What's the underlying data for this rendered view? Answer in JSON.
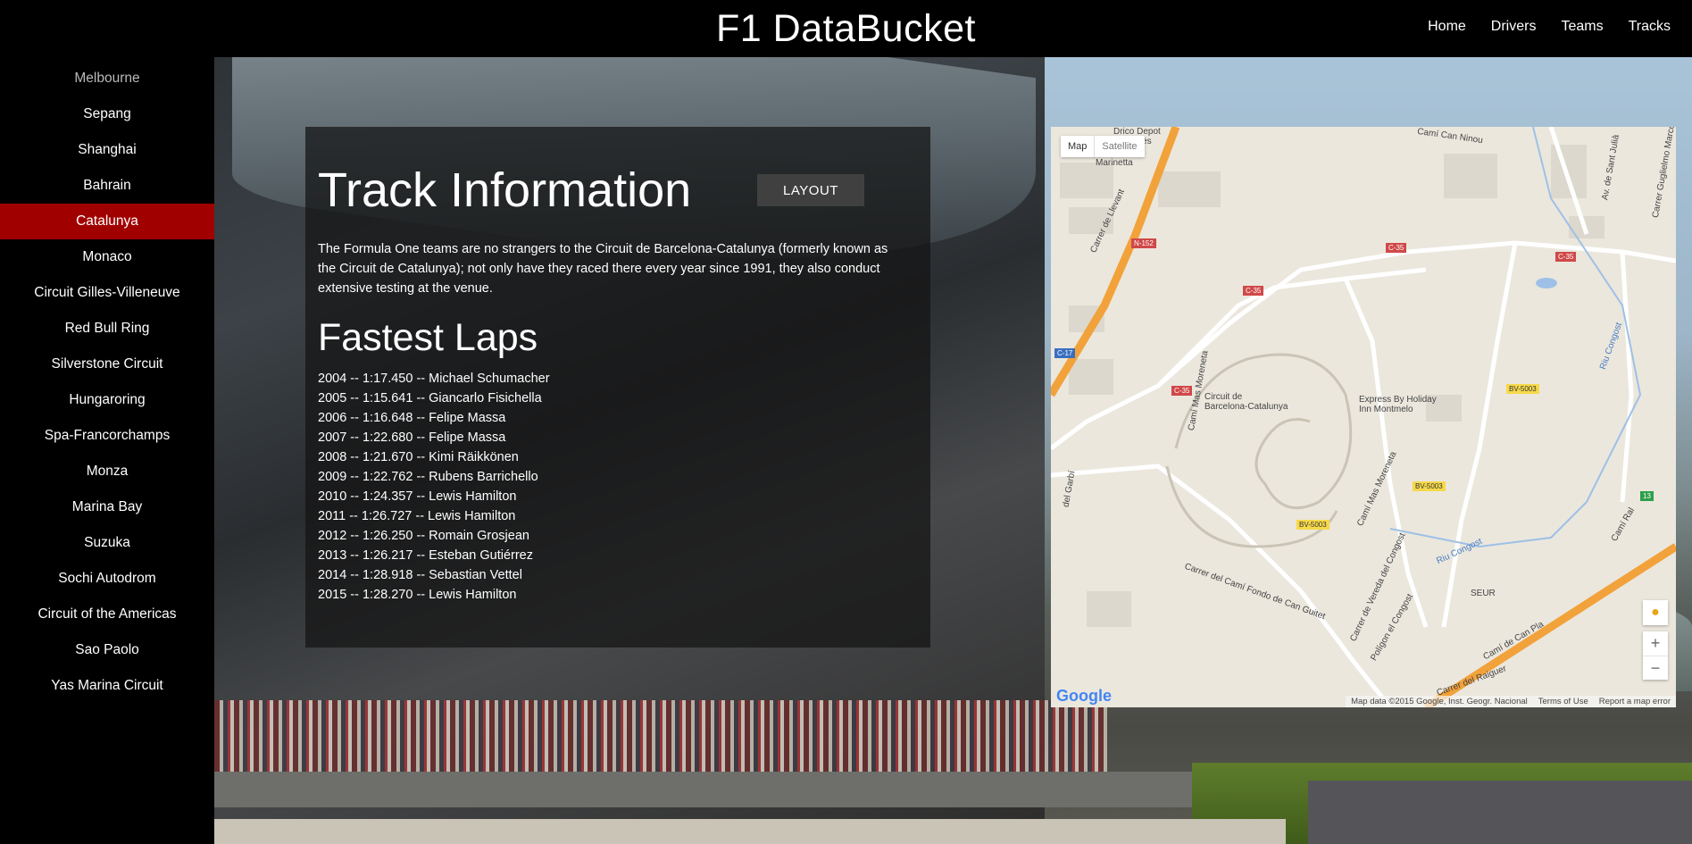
{
  "header": {
    "brand": "F1 DataBucket",
    "nav": [
      "Home",
      "Drivers",
      "Teams",
      "Tracks"
    ]
  },
  "sidebar": {
    "items": [
      {
        "label": "Melbourne",
        "state": "dim"
      },
      {
        "label": "Sepang",
        "state": ""
      },
      {
        "label": "Shanghai",
        "state": ""
      },
      {
        "label": "Bahrain",
        "state": ""
      },
      {
        "label": "Catalunya",
        "state": "active"
      },
      {
        "label": "Monaco",
        "state": ""
      },
      {
        "label": "Circuit Gilles-Villeneuve",
        "state": ""
      },
      {
        "label": "Red Bull Ring",
        "state": ""
      },
      {
        "label": "Silverstone Circuit",
        "state": ""
      },
      {
        "label": "Hungaroring",
        "state": ""
      },
      {
        "label": "Spa-Francorchamps",
        "state": ""
      },
      {
        "label": "Monza",
        "state": ""
      },
      {
        "label": "Marina Bay",
        "state": ""
      },
      {
        "label": "Suzuka",
        "state": ""
      },
      {
        "label": "Sochi Autodrom",
        "state": ""
      },
      {
        "label": "Circuit of the Americas",
        "state": ""
      },
      {
        "label": "Sao Paolo",
        "state": ""
      },
      {
        "label": "Yas Marina Circuit",
        "state": ""
      }
    ]
  },
  "info": {
    "title": "Track Information",
    "layout_button": "LAYOUT",
    "description": "The Formula One teams are no strangers to the Circuit de Barcelona-Catalunya (formerly known as the Circuit de Catalunya); not only have they raced there every year since 1991, they also conduct extensive testing at the venue.",
    "fastest_laps_title": "Fastest Laps",
    "fastest_laps": [
      "2004 -- 1:17.450 -- Michael Schumacher",
      "2005 -- 1:15.641 -- Giancarlo Fisichella",
      "2006 -- 1:16.648 -- Felipe Massa",
      "2007 -- 1:22.680 -- Felipe Massa",
      "2008 -- 1:21.670 -- Kimi Räikkönen",
      "2009 -- 1:22.762 -- Rubens Barrichello",
      "2010 -- 1:24.357 -- Lewis Hamilton",
      "2011 -- 1:26.727 -- Lewis Hamilton",
      "2012 -- 1:26.250 -- Romain Grosjean",
      "2013 -- 1:26.217 -- Esteban Gutiérrez",
      "2014 -- 1:28.918 -- Sebastian Vettel",
      "2015 -- 1:28.270 -- Lewis Hamilton"
    ]
  },
  "map": {
    "type_map": "Map",
    "type_satellite": "Satellite",
    "zoom_in": "+",
    "zoom_out": "−",
    "google": "Google",
    "footer": [
      "Map data ©2015 Google, Inst. Geogr. Nacional",
      "Terms of Use",
      "Report a map error"
    ],
    "labels": {
      "circuit": "Circuit de\nBarcelona-Catalunya",
      "hotel": "Express By Holiday\nInn Montmelo",
      "seur": "SEUR",
      "riu_congost": "Riu Congost",
      "cami_mas_moreneta": "Camí Mas Moreneta",
      "cami_can_ninou": "Camí Can Ninou",
      "carrer_llevant": "Carrer de Llevant",
      "carrer_fondo": "Carrer del Camí Fondo de Can Guitet",
      "poligon": "Polígon el Congost",
      "vereda": "Carrer de Vereda del Congost",
      "cami_can_pla": "Camí de Can Pla",
      "av_sant_julia": "Av. de Sant Julià",
      "carrer_guglielmo": "Carrer Guglielmo Marconi",
      "cami_ral": "Camí Ral",
      "del_garbi": "del Garbí",
      "raiguer": "Carrer del Raiguer",
      "depot": "Drico Depot\ndel Vallès",
      "marinetta": "Marinetta"
    },
    "badges": [
      "N-152",
      "C-35",
      "C-35",
      "C-35",
      "C-35",
      "C-17",
      "BV-5003",
      "BV-5003",
      "BV-5003",
      "13"
    ]
  }
}
